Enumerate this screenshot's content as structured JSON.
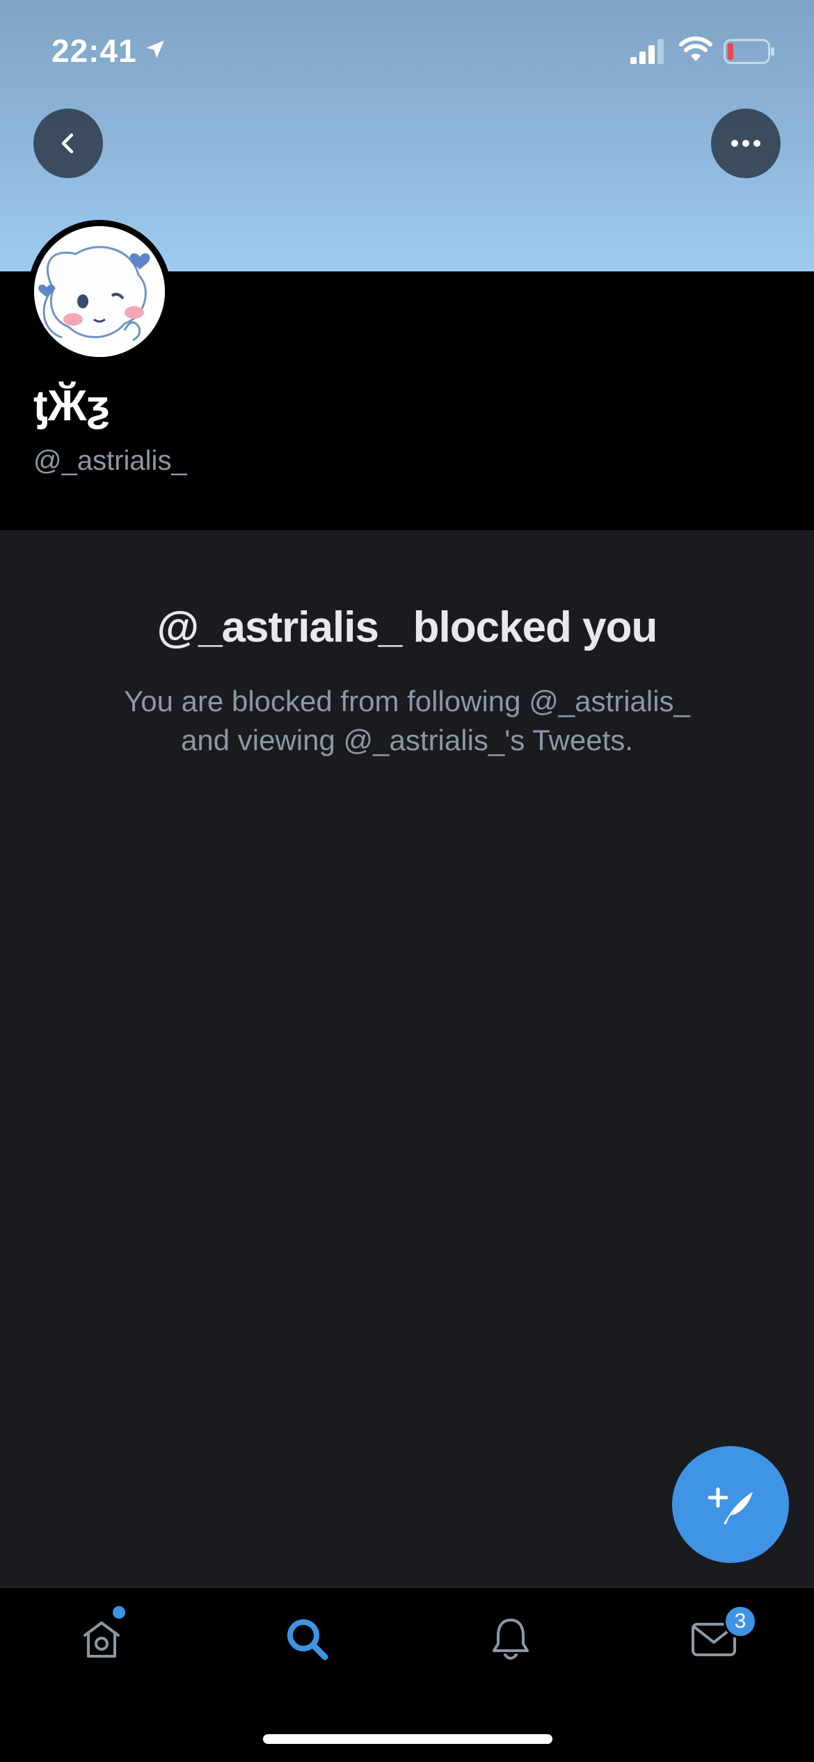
{
  "status_bar": {
    "time": "22:41",
    "icons": [
      "location-arrow-icon",
      "cellular-signal-icon",
      "wifi-icon",
      "battery-low-icon"
    ],
    "battery_color": "#e5484d"
  },
  "nav": {
    "back_icon": "chevron-left-icon",
    "more_icon": "more-horizontal-icon"
  },
  "profile": {
    "display_name": "ƫӁƺ",
    "handle": "@_astrialis_"
  },
  "blocked": {
    "title": "@_astrialis_ blocked you",
    "line1": "You are blocked from following @_astrialis_",
    "line2": "and viewing @_astrialis_'s Tweets."
  },
  "fab": {
    "icon": "compose-tweet-icon"
  },
  "tab_bar": {
    "tabs": [
      {
        "name": "home",
        "icon": "home-icon",
        "has_dot": true
      },
      {
        "name": "search",
        "icon": "search-icon",
        "active": true
      },
      {
        "name": "notifications",
        "icon": "bell-icon"
      },
      {
        "name": "messages",
        "icon": "mail-icon",
        "badge": "3"
      }
    ]
  },
  "colors": {
    "accent": "#3f94e6",
    "background": "#1a1b1f",
    "header_background": "#000000",
    "secondary_text": "#8b98a5"
  }
}
